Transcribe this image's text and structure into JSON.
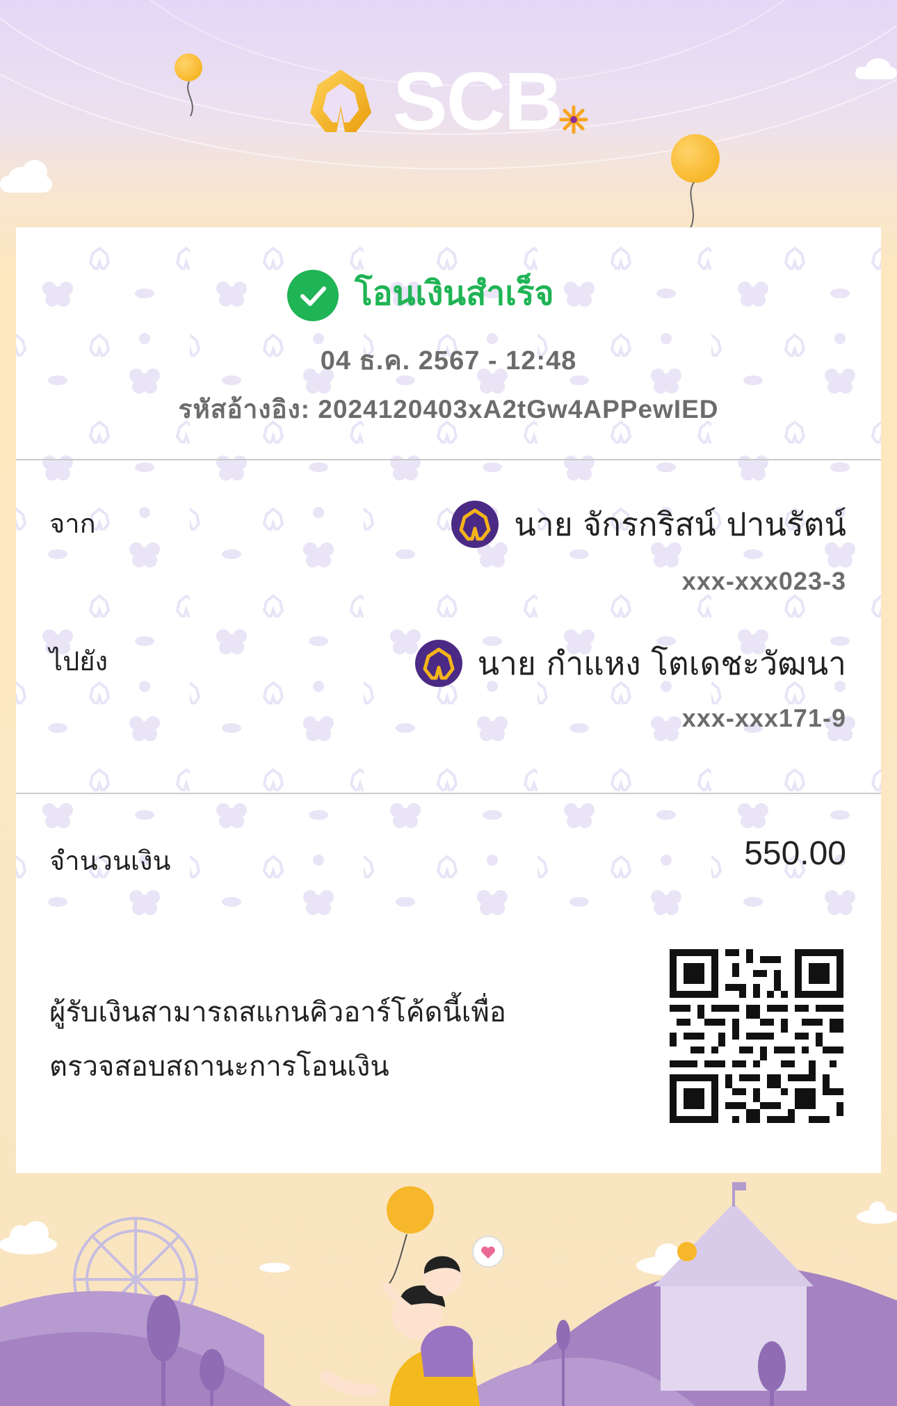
{
  "brand": {
    "name": "SCB"
  },
  "status": {
    "text": "โอนเงินสำเร็จ",
    "color": "#1fb455"
  },
  "datetime": "04 ธ.ค. 2567 - 12:48",
  "reference": {
    "label": "รหัสอ้างอิง:",
    "value": "2024120403xA2tGw4APPewIED"
  },
  "from": {
    "label": "จาก",
    "name": "นาย จักรกริสน์ ปานรัตน์",
    "account": "xxx-xxx023-3",
    "bank_icon": "scb-bank-icon"
  },
  "to": {
    "label": "ไปยัง",
    "name": "นาย กำแหง โตเดชะวัฒนา",
    "account": "xxx-xxx171-9",
    "bank_icon": "scb-bank-icon"
  },
  "amount": {
    "label": "จำนวนเงิน",
    "value": "550.00"
  },
  "qr_note": {
    "line1": "ผู้รับเงินสามารถสแกนคิวอาร์โค้ดนี้เพื่อ",
    "line2": "ตรวจสอบสถานะการโอนเงิน"
  },
  "colors": {
    "brand_purple": "#4b2a85",
    "brand_gold": "#f4b41a",
    "background_lavender": "#e3d8f7",
    "background_cream": "#fde7bd"
  },
  "icons": [
    "scb-logo-icon",
    "check-circle-icon",
    "scb-bank-icon",
    "qr-code",
    "balloon-icon",
    "cloud-icon",
    "ferris-wheel-icon",
    "tent-icon"
  ]
}
